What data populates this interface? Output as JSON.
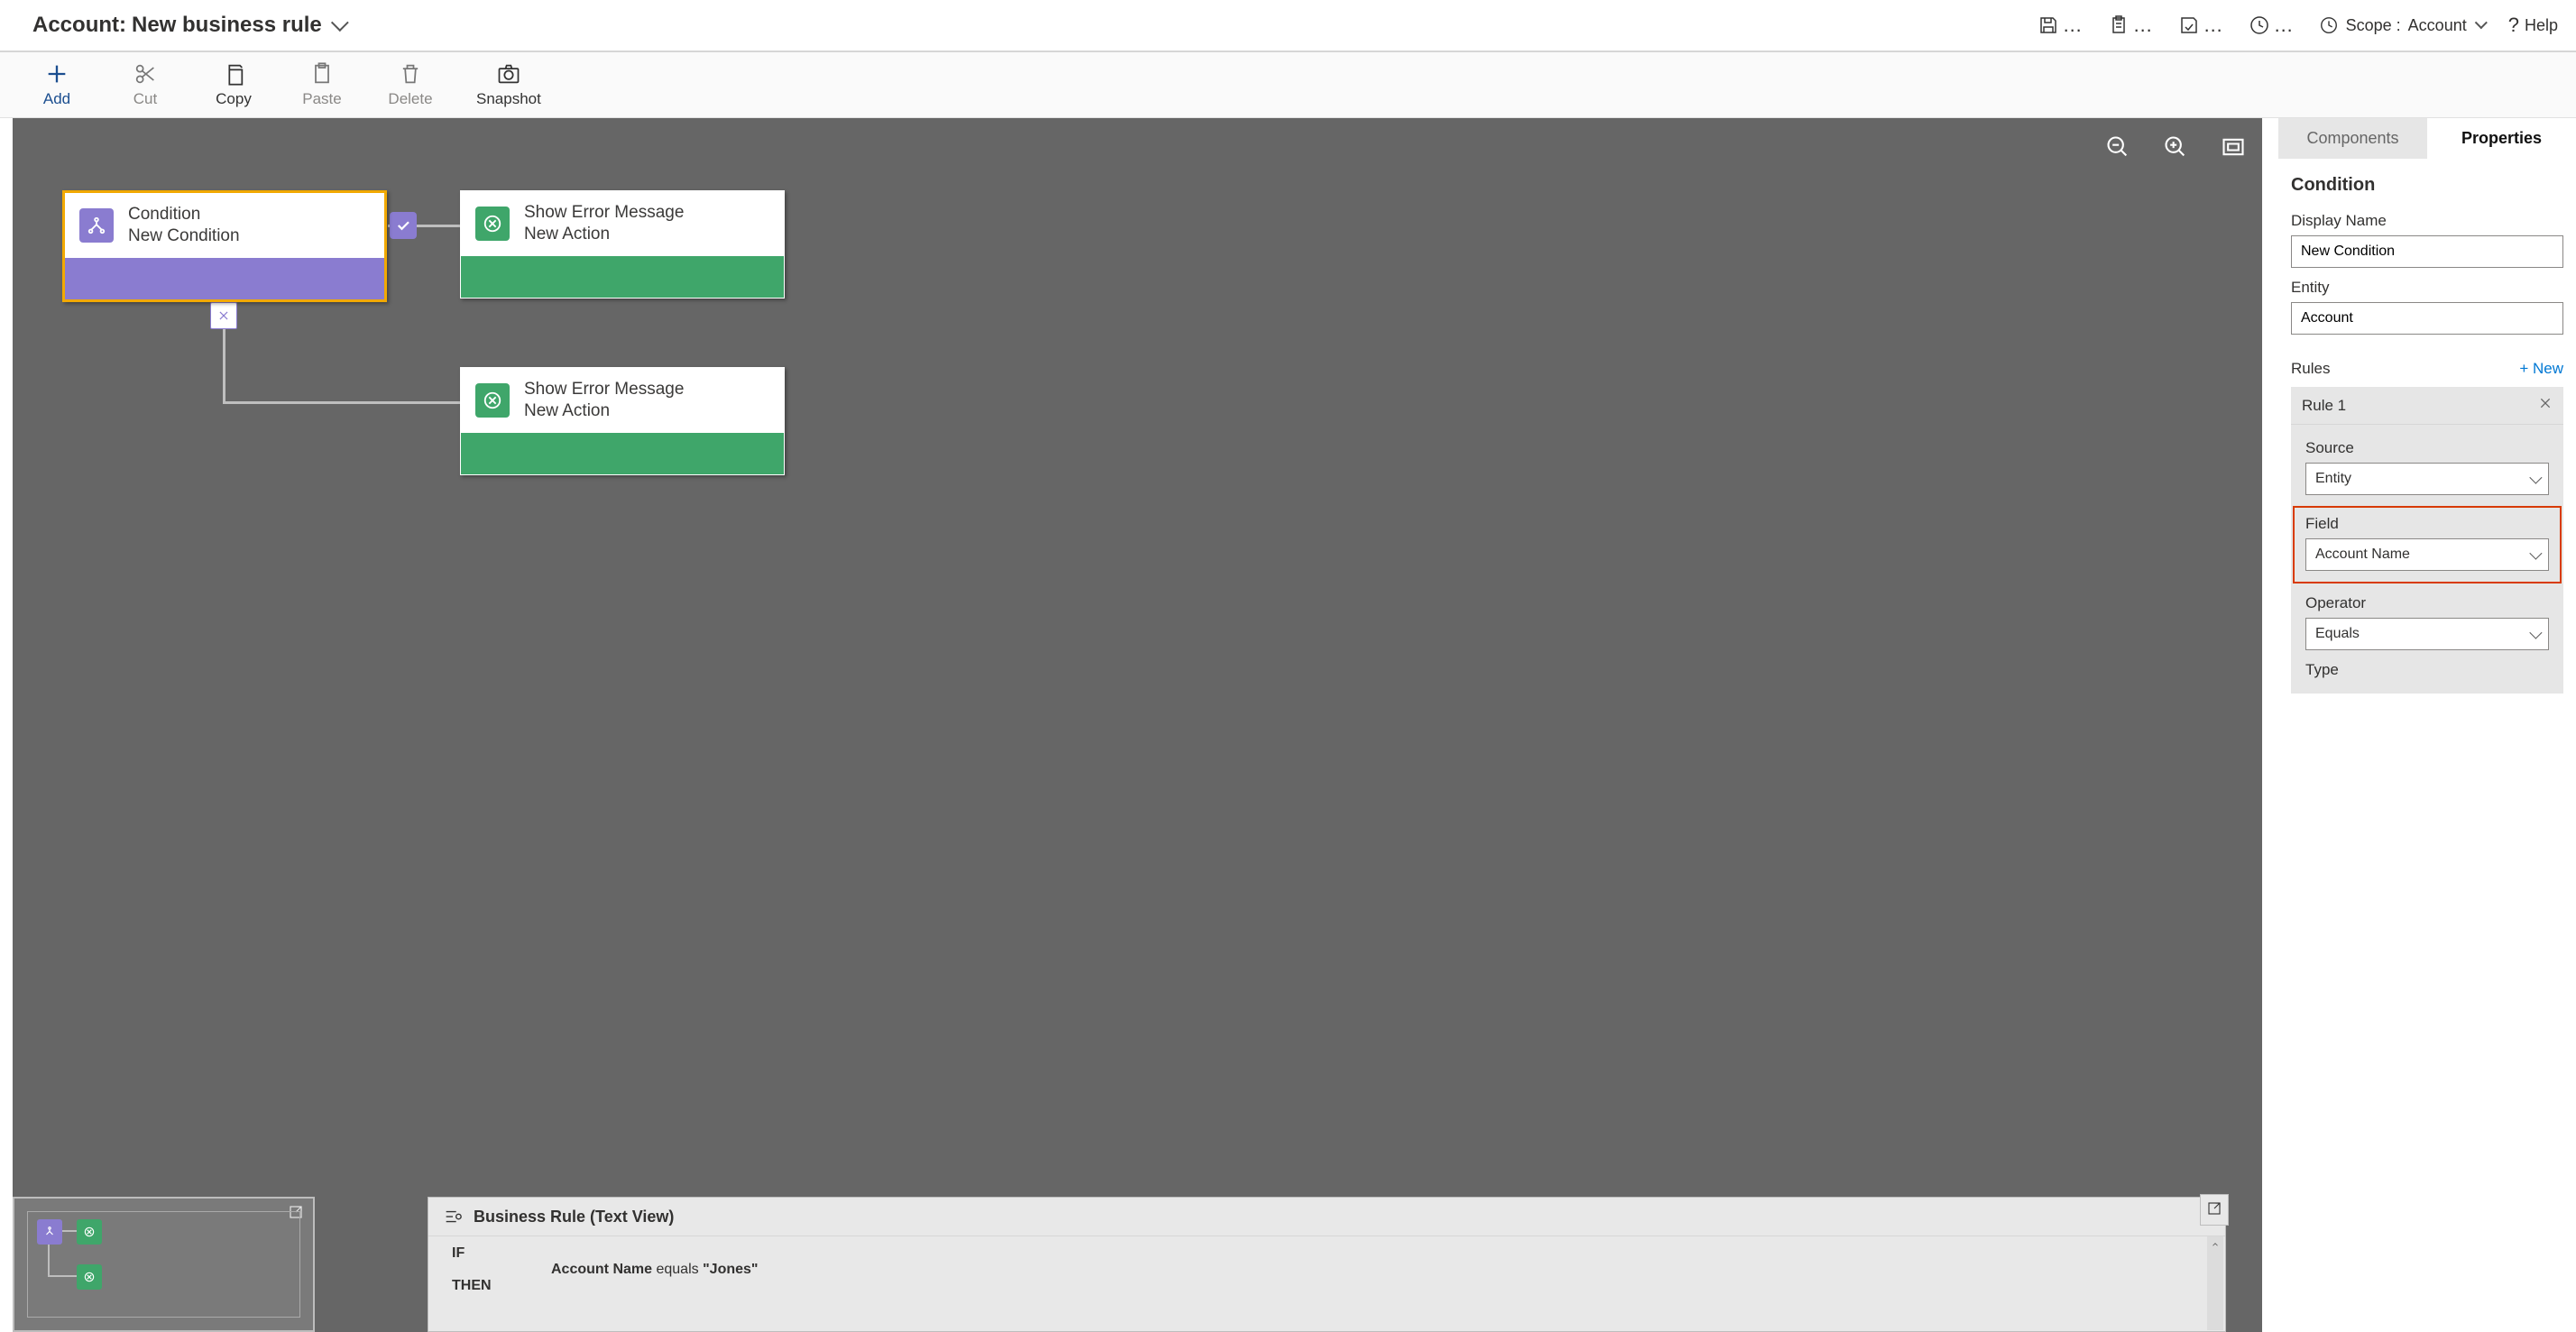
{
  "header": {
    "entity_label": "Account:",
    "rule_name": "New business rule",
    "scope_label": "Scope :",
    "scope_value": "Account",
    "help_label": "Help"
  },
  "toolbar": {
    "add": "Add",
    "cut": "Cut",
    "copy": "Copy",
    "paste": "Paste",
    "delete": "Delete",
    "snapshot": "Snapshot"
  },
  "canvas": {
    "condition": {
      "title": "Condition",
      "subtitle": "New Condition"
    },
    "action1": {
      "title": "Show Error Message",
      "subtitle": "New Action"
    },
    "action2": {
      "title": "Show Error Message",
      "subtitle": "New Action"
    }
  },
  "textview": {
    "title": "Business Rule (Text View)",
    "if": "IF",
    "then": "THEN",
    "expr_field": "Account Name",
    "expr_op": "equals",
    "expr_val": "\"Jones\""
  },
  "props": {
    "tab_components": "Components",
    "tab_properties": "Properties",
    "section_title": "Condition",
    "display_name_label": "Display Name",
    "display_name_value": "New Condition",
    "entity_label": "Entity",
    "entity_value": "Account",
    "rules_label": "Rules",
    "new_label": "+  New",
    "rule1_label": "Rule 1",
    "source_label": "Source",
    "source_value": "Entity",
    "field_label": "Field",
    "field_value": "Account Name",
    "operator_label": "Operator",
    "operator_value": "Equals",
    "type_label": "Type"
  }
}
